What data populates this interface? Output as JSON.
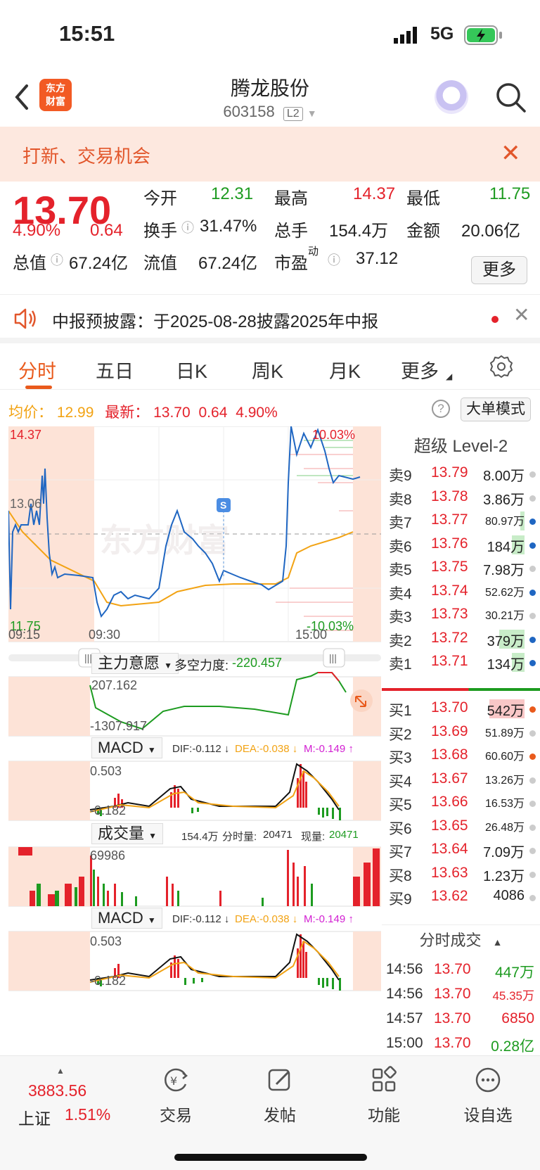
{
  "status_bar": {
    "time": "15:51",
    "network": "5G"
  },
  "header": {
    "logo_line1": "东方",
    "logo_line2": "财富",
    "title": "腾龙股份",
    "code": "603158",
    "badge": "L2"
  },
  "banner": {
    "text": "打新、交易机会"
  },
  "quote": {
    "price": "13.70",
    "change_pct": "4.90%",
    "change": "0.64",
    "open_label": "今开",
    "open": "12.31",
    "high_label": "最高",
    "high": "14.37",
    "low_label": "最低",
    "low": "11.75",
    "turnover_label": "换手",
    "turnover": "31.47%",
    "volume_label": "总手",
    "volume": "154.4万",
    "amount_label": "金额",
    "amount": "20.06亿",
    "mktcap_label": "总值",
    "mktcap": "67.24亿",
    "float_label": "流值",
    "float": "67.24亿",
    "pe_label": "市盈",
    "pe_sup": "动",
    "pe": "37.12",
    "more": "更多"
  },
  "notice": {
    "text": "中报预披露：于2025-08-28披露2025年中报"
  },
  "tabs": [
    {
      "label": "分时"
    },
    {
      "label": "五日"
    },
    {
      "label": "日K"
    },
    {
      "label": "周K"
    },
    {
      "label": "月K"
    },
    {
      "label": "更多"
    }
  ],
  "avg_line": {
    "avg_label": "均价：",
    "avg": "12.99",
    "last_label": "最新：",
    "last": "13.70",
    "chg": "0.64",
    "pct": "4.90%"
  },
  "big_order_mode": "大单模式",
  "chart": {
    "y_top": "14.37",
    "y_mid": "13.06",
    "y_bot": "11.75",
    "pct_top": "10.03%",
    "pct_bot": "-10.03%",
    "t1": "09:15",
    "t2": "09:30",
    "t3": "15:00",
    "watermark": "东方财富",
    "marker": "S"
  },
  "ind1": {
    "select": "主力意愿",
    "label": "多空力度:",
    "value": "-220.457",
    "max": "207.162",
    "min": "-1307.917"
  },
  "macd": {
    "select": "MACD",
    "dif": "DIF:-0.112 ↓",
    "dea": "DEA:-0.038 ↓",
    "m": "M:-0.149 ↑",
    "max": "0.503",
    "min": "-0.182"
  },
  "vol": {
    "select": "成交量",
    "total": "154.4万",
    "fs_label": "分时量:",
    "fs": "20471",
    "now_label": "现量:",
    "now": "20471",
    "max": "69986"
  },
  "macd2": {
    "select": "MACD",
    "dif": "DIF:-0.112 ↓",
    "dea": "DEA:-0.038 ↓",
    "m": "M:-0.149 ↑",
    "max": "0.503",
    "min": "-0.182"
  },
  "order_book": {
    "header": "超级 Level-2",
    "asks": [
      {
        "name": "卖9",
        "price": "13.79",
        "vol": "8.00万"
      },
      {
        "name": "卖8",
        "price": "13.78",
        "vol": "3.86万"
      },
      {
        "name": "卖7",
        "price": "13.77",
        "vol": "80.97万"
      },
      {
        "name": "卖6",
        "price": "13.76",
        "vol": "184万"
      },
      {
        "name": "卖5",
        "price": "13.75",
        "vol": "7.98万"
      },
      {
        "name": "卖4",
        "price": "13.74",
        "vol": "52.62万"
      },
      {
        "name": "卖3",
        "price": "13.73",
        "vol": "30.21万"
      },
      {
        "name": "卖2",
        "price": "13.72",
        "vol": "379万"
      },
      {
        "name": "卖1",
        "price": "13.71",
        "vol": "134万"
      }
    ],
    "bids": [
      {
        "name": "买1",
        "price": "13.70",
        "vol": "542万"
      },
      {
        "name": "买2",
        "price": "13.69",
        "vol": "51.89万"
      },
      {
        "name": "买3",
        "price": "13.68",
        "vol": "60.60万"
      },
      {
        "name": "买4",
        "price": "13.67",
        "vol": "13.26万"
      },
      {
        "name": "买5",
        "price": "13.66",
        "vol": "16.53万"
      },
      {
        "name": "买6",
        "price": "13.65",
        "vol": "26.48万"
      },
      {
        "name": "买7",
        "price": "13.64",
        "vol": "7.09万"
      },
      {
        "name": "买8",
        "price": "13.63",
        "vol": "1.23万"
      },
      {
        "name": "买9",
        "price": "13.62",
        "vol": "4086"
      }
    ],
    "ts_header": "分时成交",
    "trades": [
      {
        "time": "14:56",
        "price": "13.70",
        "vol": "447万"
      },
      {
        "time": "14:56",
        "price": "13.70",
        "vol": "45.35万"
      },
      {
        "time": "14:57",
        "price": "13.70",
        "vol": "6850"
      },
      {
        "time": "15:00",
        "price": "13.70",
        "vol": "0.28亿"
      }
    ]
  },
  "bottom_bar": {
    "index_value": "3883.56",
    "index_name": "上证",
    "index_pct": "1.51%",
    "items": [
      {
        "label": "交易"
      },
      {
        "label": "发帖"
      },
      {
        "label": "功能"
      },
      {
        "label": "设自选"
      }
    ]
  }
}
